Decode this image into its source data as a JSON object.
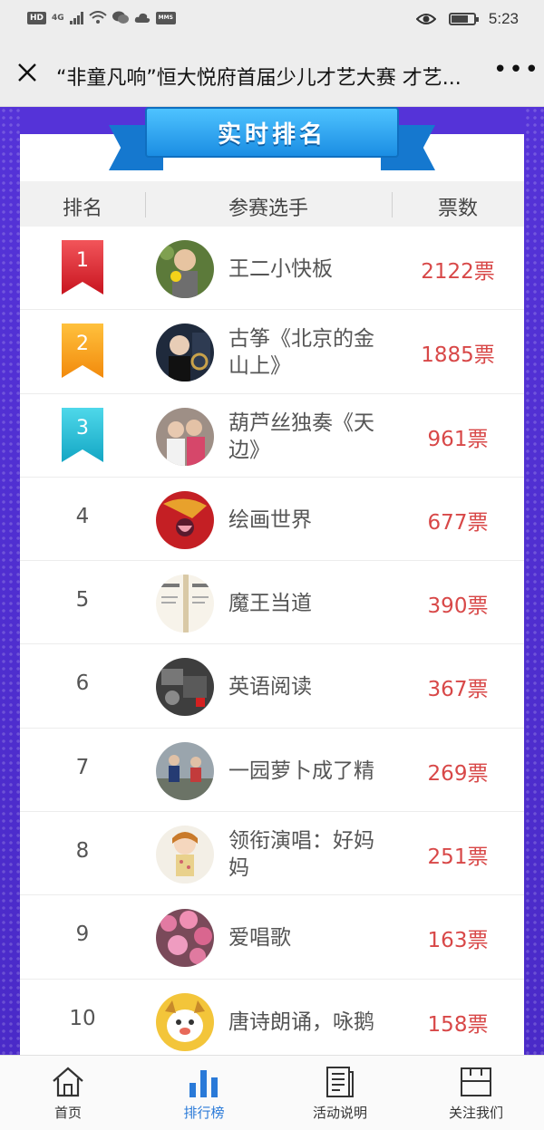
{
  "status_bar": {
    "left_chip_hd": "HD",
    "network": "4G",
    "time": "5:23"
  },
  "title_bar": {
    "title": "“非童凡响”恒大悦府首届少儿才艺大赛 才艺...",
    "more": "•••"
  },
  "banner": {
    "title": "实时排名"
  },
  "table": {
    "headers": {
      "rank": "排名",
      "player": "参赛选手",
      "votes": "票数"
    },
    "rows": [
      {
        "rank": "1",
        "name": "王二小快板",
        "votes": "2122票",
        "medal": "red",
        "avatar": "kid-yellow"
      },
      {
        "rank": "2",
        "name": "古筝《北京的金山上》",
        "votes": "1885票",
        "medal": "orange",
        "avatar": "dark-portrait"
      },
      {
        "rank": "3",
        "name": "葫芦丝独奏《天边》",
        "votes": "961票",
        "medal": "cyan",
        "avatar": "kids-photo"
      },
      {
        "rank": "4",
        "name": "绘画世界",
        "votes": "677票",
        "medal": "",
        "avatar": "red-art"
      },
      {
        "rank": "5",
        "name": "魔王当道",
        "votes": "390票",
        "medal": "",
        "avatar": "document"
      },
      {
        "rank": "6",
        "name": "英语阅读",
        "votes": "367票",
        "medal": "",
        "avatar": "engine"
      },
      {
        "rank": "7",
        "name": "一园萝卜成了精",
        "votes": "269票",
        "medal": "",
        "avatar": "outdoor"
      },
      {
        "rank": "8",
        "name": "领衔演唱：好妈妈",
        "votes": "251票",
        "medal": "",
        "avatar": "cartoon-girl"
      },
      {
        "rank": "9",
        "name": "爱唱歌",
        "votes": "163票",
        "medal": "",
        "avatar": "pink-flowers"
      },
      {
        "rank": "10",
        "name": "唐诗朗诵，咏鹅",
        "votes": "158票",
        "medal": "",
        "avatar": "cartoon-dog"
      }
    ]
  },
  "bottom_nav": [
    {
      "label": "首页",
      "icon": "home-icon"
    },
    {
      "label": "排行榜",
      "icon": "bar-chart-icon",
      "active": true
    },
    {
      "label": "活动说明",
      "icon": "document-icon"
    },
    {
      "label": "关注我们",
      "icon": "follow-icon"
    }
  ],
  "colors": {
    "accent_blue": "#2a7ad8",
    "vote_red": "#d84848",
    "background_purple": "#5533d8"
  }
}
